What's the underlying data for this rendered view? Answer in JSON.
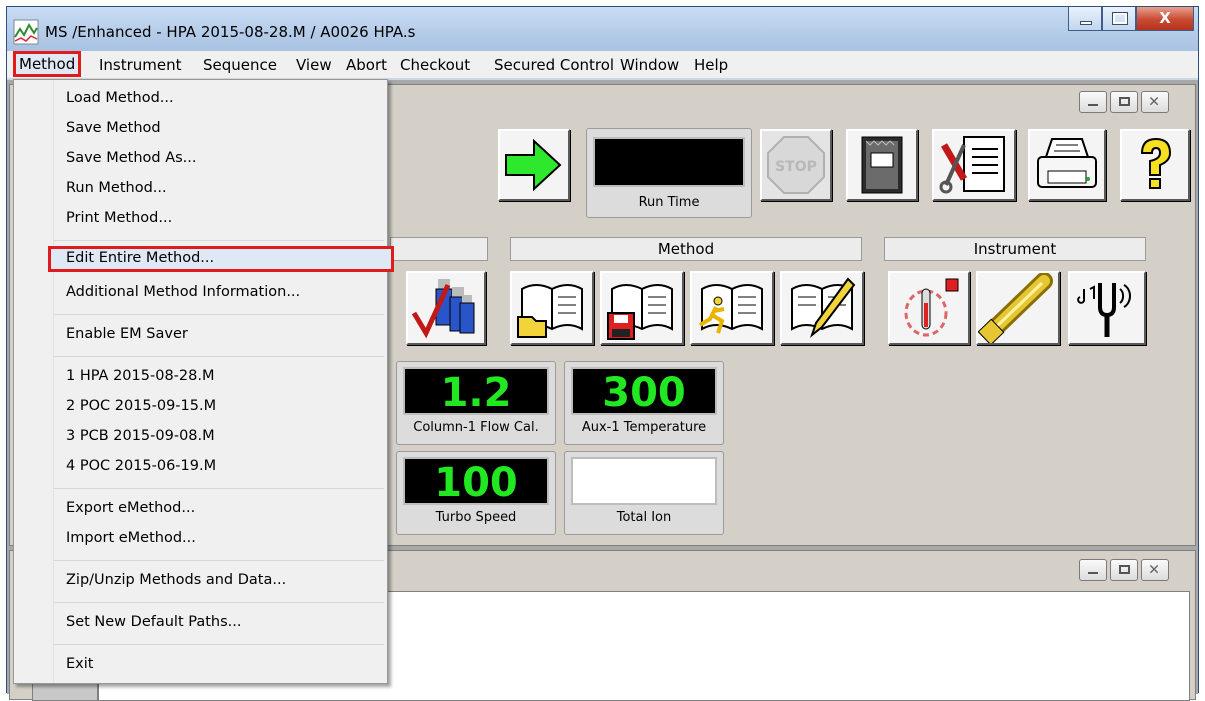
{
  "window": {
    "title": "MS /Enhanced - HPA 2015-08-28.M / A0026 HPA.s",
    "close_label": "X"
  },
  "menubar": {
    "items": [
      "Method",
      "Instrument",
      "Sequence",
      "View",
      "Abort",
      "Checkout",
      "Secured Control",
      "Window",
      "Help"
    ],
    "active": "Method"
  },
  "method_menu": {
    "items": [
      "Load Method...",
      "Save Method",
      "Save Method As...",
      "Run Method...",
      "Print Method...",
      "Edit Entire Method...",
      "Additional Method Information...",
      "Enable EM Saver",
      "1 HPA 2015-08-28.M",
      "2 POC 2015-09-15.M",
      "3 PCB 2015-09-08.M",
      "4 POC 2015-06-19.M",
      "Export eMethod...",
      "Import eMethod...",
      "Zip/Unzip Methods and Data...",
      "Set New Default Paths...",
      "Exit"
    ],
    "highlighted": "Edit Entire Method..."
  },
  "toolbar": {
    "run_time_label": "Run Time",
    "stop_label": "STOP",
    "help_icon": "question-mark-icon"
  },
  "groups": {
    "method": "Method",
    "instrument": "Instrument"
  },
  "displays": {
    "column_flow": {
      "value": "1.2",
      "label": "Column-1 Flow Cal."
    },
    "aux_temp": {
      "value": "300",
      "label": "Aux-1 Temperature"
    },
    "turbo": {
      "value": "100",
      "label": "Turbo Speed"
    },
    "total_ion": {
      "value": "",
      "label": "Total Ion"
    }
  },
  "colors": {
    "highlight_red": "#e01b1b",
    "readout_green": "#22e822"
  }
}
